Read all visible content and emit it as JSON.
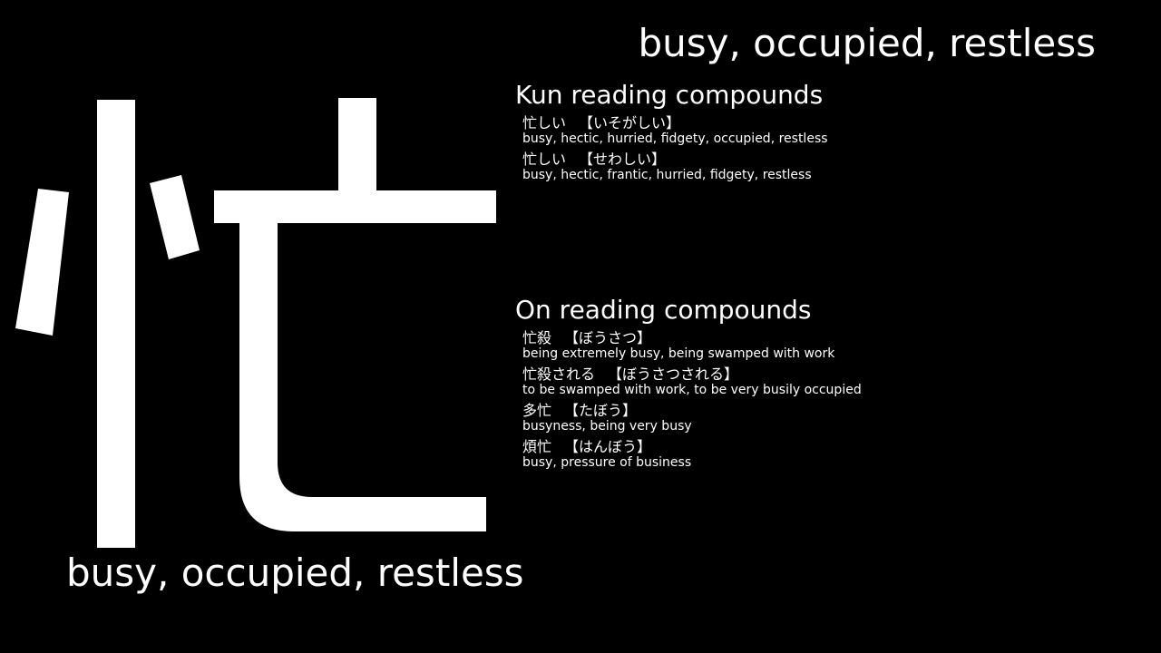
{
  "kanji": {
    "character": "忙",
    "meaning_top": "busy, occupied, restless",
    "meaning_bottom": "busy, occupied, restless"
  },
  "kun": {
    "title": "Kun reading compounds",
    "entries": [
      {
        "word": "忙しい",
        "reading": "【いそがしい】",
        "definition": "busy, hectic, hurried, fidgety, occupied, restless"
      },
      {
        "word": "忙しい",
        "reading": "【せわしい】",
        "definition": "busy, hectic, frantic, hurried, fidgety, restless"
      }
    ]
  },
  "on": {
    "title": "On reading compounds",
    "entries": [
      {
        "word": "忙殺",
        "reading": "【ぼうさつ】",
        "definition": "being extremely busy, being swamped with work"
      },
      {
        "word": "忙殺される",
        "reading": "【ぼうさつされる】",
        "definition": "to be swamped with work, to be very busily occupied"
      },
      {
        "word": "多忙",
        "reading": "【たぼう】",
        "definition": "busyness, being very busy"
      },
      {
        "word": "煩忙",
        "reading": "【はんぼう】",
        "definition": "busy, pressure of business"
      }
    ]
  },
  "colors": {
    "background": "#000000",
    "text": "#ffffff"
  }
}
